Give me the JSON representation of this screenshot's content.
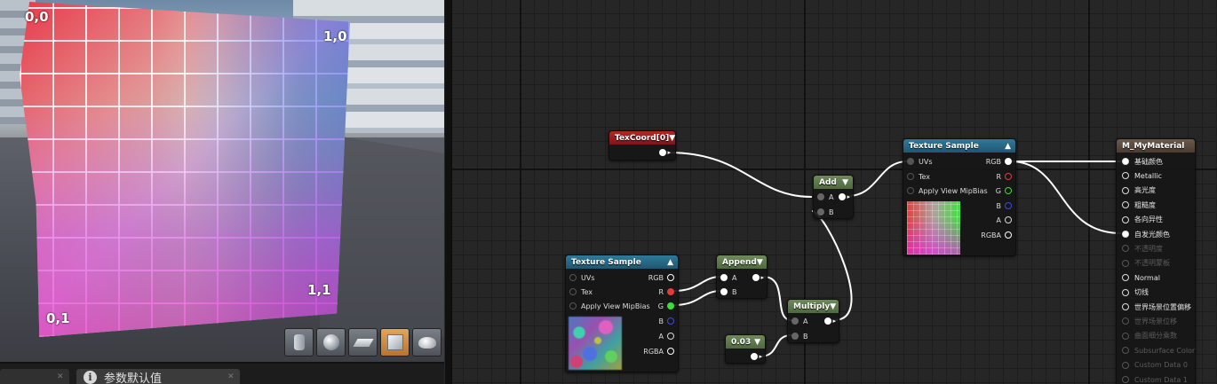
{
  "viewport": {
    "corner_labels": {
      "top_left": "0,0",
      "top_right": "1,0",
      "bottom_left": "0,1",
      "bottom_right": "1,1"
    },
    "shape_buttons": [
      "cylinder-icon",
      "sphere-icon",
      "plane-icon",
      "cube-icon",
      "teapot-icon"
    ],
    "active_shape": "cube-icon"
  },
  "details_panel": {
    "tab_label": "参数默认值",
    "tab_icon": "info-icon",
    "info_glyph": "i"
  },
  "nodes": {
    "texcoord": {
      "title": "TexCoord[0]"
    },
    "add": {
      "title": "Add",
      "inputs": [
        "A",
        "B"
      ]
    },
    "texture_sample_top": {
      "title": "Texture Sample",
      "inputs": [
        "UVs",
        "Tex",
        "Apply View MipBias"
      ],
      "outputs": [
        "RGB",
        "R",
        "G",
        "B",
        "A",
        "RGBA"
      ]
    },
    "texture_sample_bottom": {
      "title": "Texture Sample",
      "inputs": [
        "UVs",
        "Tex",
        "Apply View MipBias"
      ],
      "outputs": [
        "RGB",
        "R",
        "G",
        "B",
        "A",
        "RGBA"
      ]
    },
    "append": {
      "title": "Append",
      "inputs": [
        "A",
        "B"
      ]
    },
    "multiply": {
      "title": "Multiply",
      "inputs": [
        "A",
        "B"
      ]
    },
    "constant": {
      "title": "0.03"
    }
  },
  "material": {
    "title": "M_MyMaterial",
    "pins": [
      {
        "label": "基础颜色",
        "connected": true,
        "enabled": true
      },
      {
        "label": "Metallic",
        "connected": false,
        "enabled": true
      },
      {
        "label": "高光度",
        "connected": false,
        "enabled": true
      },
      {
        "label": "粗糙度",
        "connected": false,
        "enabled": true
      },
      {
        "label": "各向异性",
        "connected": false,
        "enabled": true
      },
      {
        "label": "自发光颜色",
        "connected": true,
        "enabled": true
      },
      {
        "label": "不透明度",
        "connected": false,
        "enabled": false
      },
      {
        "label": "不透明蒙板",
        "connected": false,
        "enabled": false
      },
      {
        "label": "Normal",
        "connected": false,
        "enabled": true
      },
      {
        "label": "切线",
        "connected": false,
        "enabled": true
      },
      {
        "label": "世界场景位置偏移",
        "connected": false,
        "enabled": true
      },
      {
        "label": "世界场景位移",
        "connected": false,
        "enabled": false
      },
      {
        "label": "曲面细分乘数",
        "connected": false,
        "enabled": false
      },
      {
        "label": "Subsurface Color",
        "connected": false,
        "enabled": false
      },
      {
        "label": "Custom Data 0",
        "connected": false,
        "enabled": false
      },
      {
        "label": "Custom Data 1",
        "connected": false,
        "enabled": false
      }
    ]
  },
  "colors": {
    "param_header": "#2f7a9a",
    "math_header": "#6e8a5a",
    "texcoord_header": "#b02828",
    "wire": "#ffffff"
  }
}
